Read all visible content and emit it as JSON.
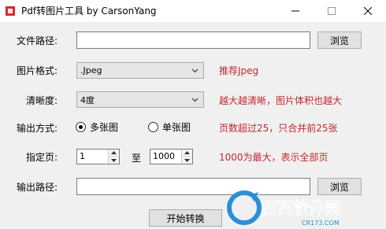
{
  "window": {
    "title": "Pdf转图片工具 by CarsonYang"
  },
  "form": {
    "file_path_label": "文件路径:",
    "file_path_value": "",
    "browse_label": "浏览",
    "format_label": "图片格式:",
    "format_value": ".Jpeg",
    "format_hint": "推荐Jpeg",
    "clarity_label": "清晰度:",
    "clarity_value": "4度",
    "clarity_hint": "越大越清晰，图片体积也越大",
    "output_mode_label": "输出方式:",
    "mode_multi": "多张图",
    "mode_single": "单张图",
    "mode_selected": "多张图",
    "mode_hint": "页数超过25，只合并前25张",
    "pages_label": "指定页:",
    "page_from": "1",
    "to_label": "至",
    "page_to": "1000",
    "pages_hint": "1000为最大，表示全部页",
    "output_path_label": "输出路径:",
    "output_path_value": "",
    "output_browse_label": "浏览",
    "start_label": "开始转换"
  },
  "watermark": {
    "brand": "西西软件园",
    "url": "CR173.COM"
  },
  "colors": {
    "hint": "#c0282d",
    "logo": "#e02727"
  }
}
